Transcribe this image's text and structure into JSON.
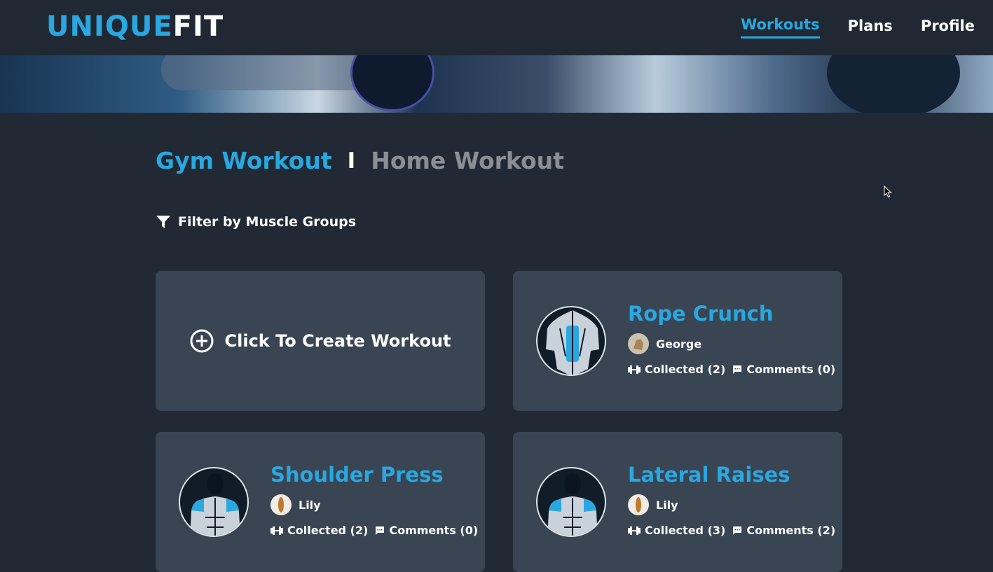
{
  "brand": {
    "part1": "UNIQUE",
    "part2": "FIT"
  },
  "nav": {
    "workouts": "Workouts",
    "plans": "Plans",
    "profile": "Profile"
  },
  "tabs": {
    "gym": "Gym Workout",
    "separator": "I",
    "home": "Home Workout"
  },
  "filter": {
    "label": "Filter by Muscle Groups"
  },
  "create": {
    "label": "Click To Create Workout"
  },
  "workouts": [
    {
      "title": "Rope Crunch",
      "author": "George",
      "collected": "Collected (2)",
      "comments": "Comments (0)"
    },
    {
      "title": "Shoulder Press",
      "author": "Lily",
      "collected": "Collected (2)",
      "comments": "Comments (0)"
    },
    {
      "title": "Lateral Raises",
      "author": "Lily",
      "collected": "Collected (3)",
      "comments": "Comments (2)"
    }
  ],
  "colors": {
    "accent": "#2aa7e0",
    "background": "#212a34",
    "card": "#394553",
    "muted": "#8a8f96"
  }
}
